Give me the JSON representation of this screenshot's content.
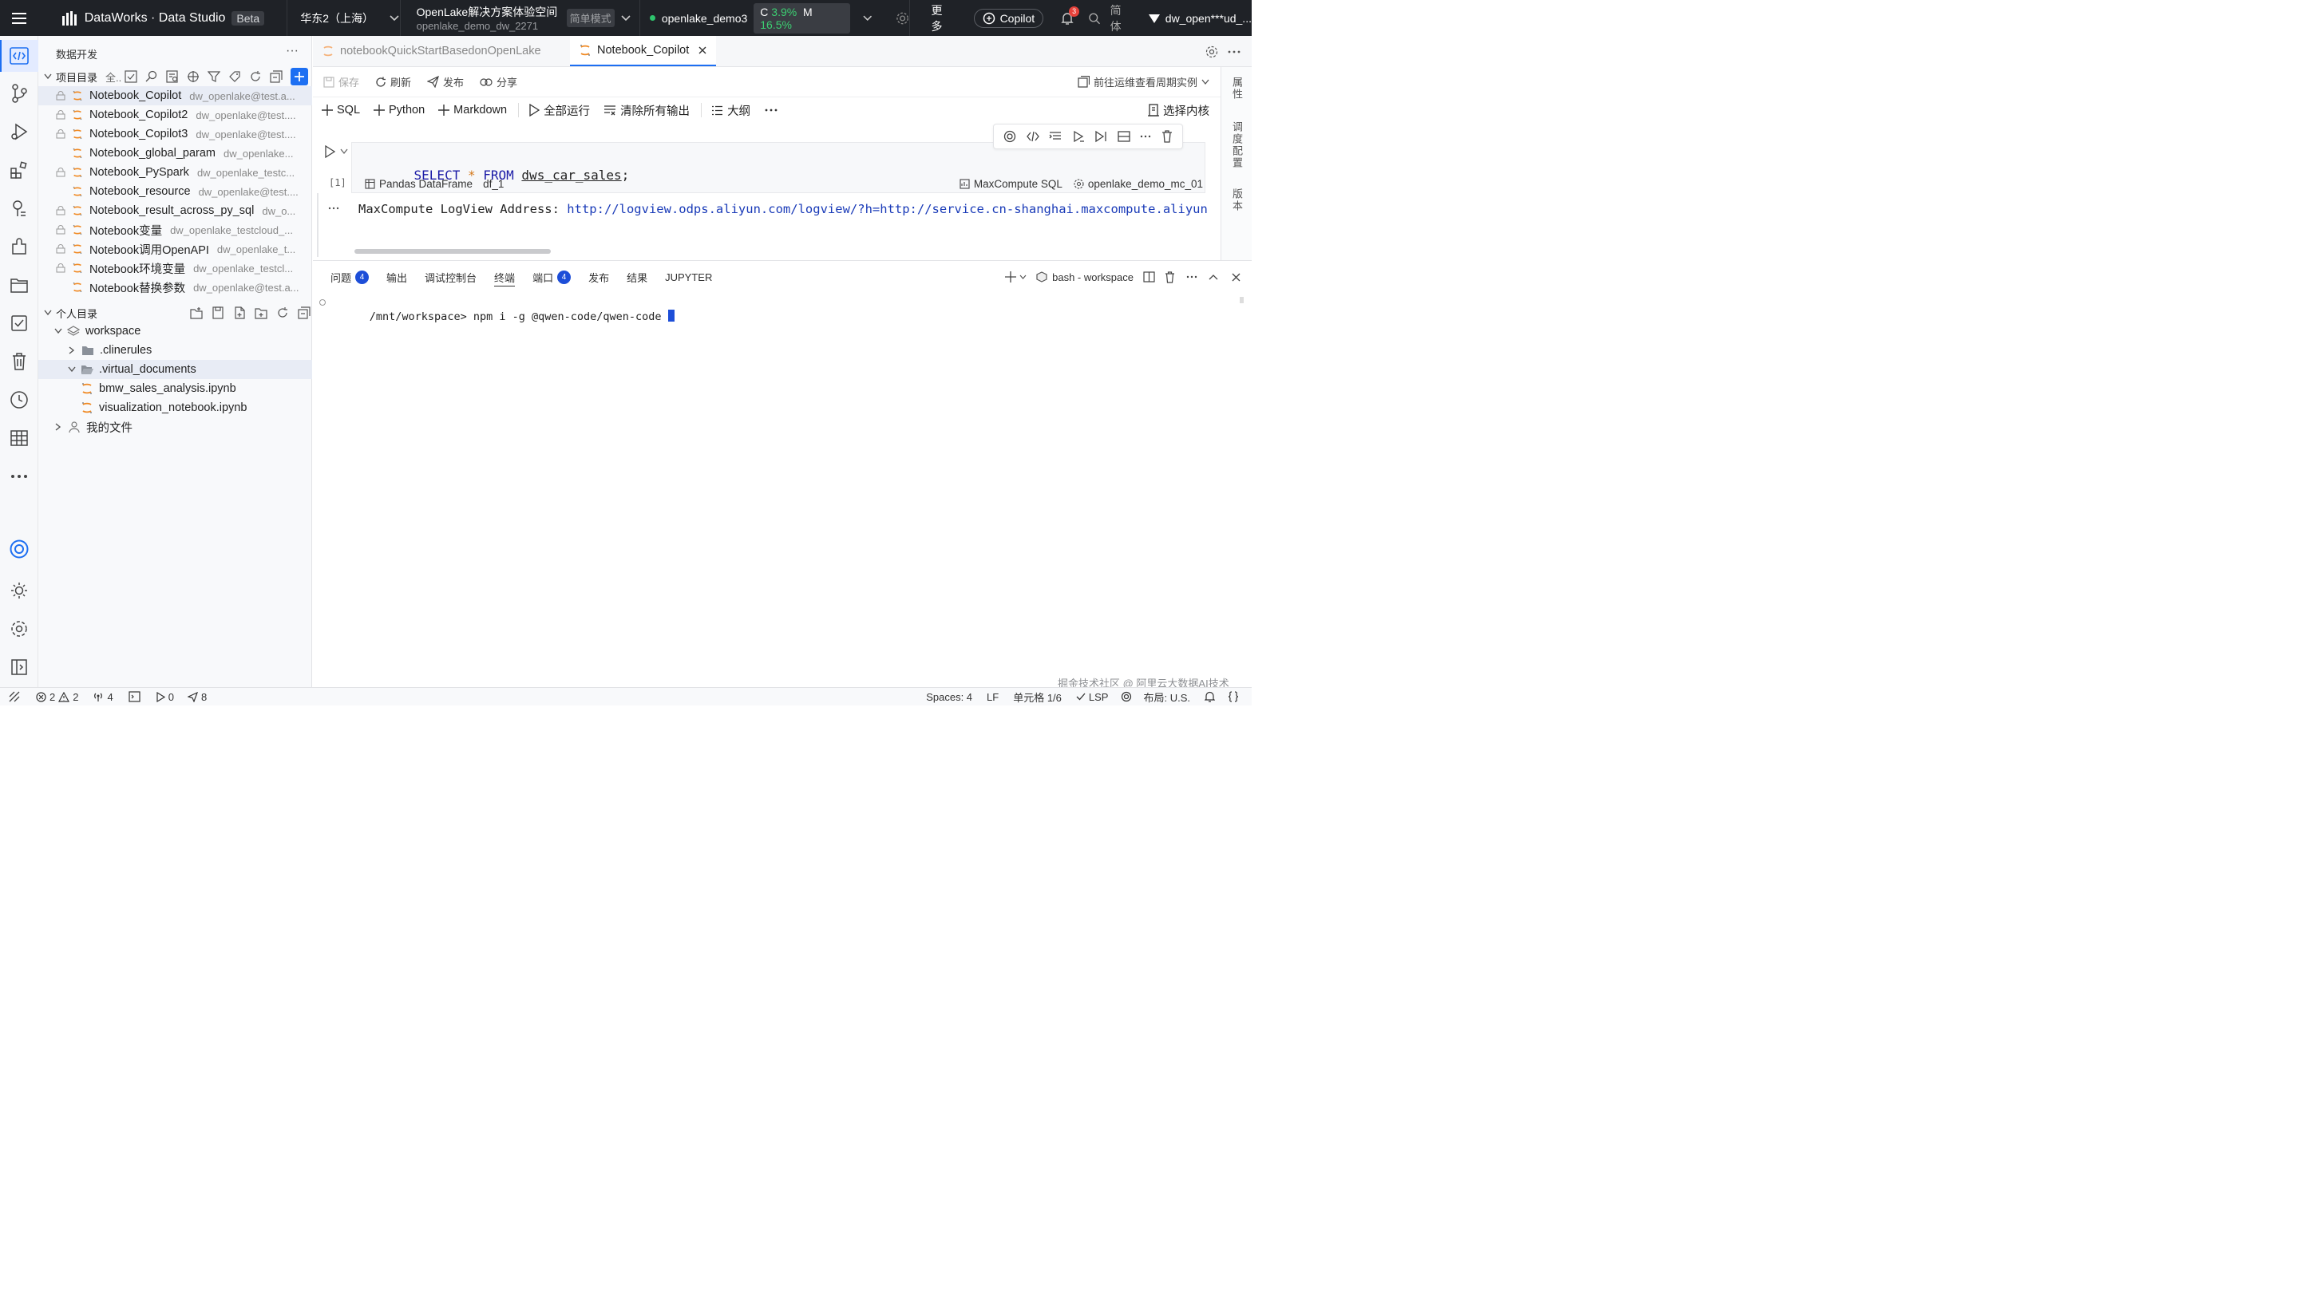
{
  "topbar": {
    "app_name": "DataWorks · Data Studio",
    "beta": "Beta",
    "region": "华东2（上海）",
    "workspace_name": "OpenLake解决方案体验空间",
    "workspace_id": "openlake_demo_dw_2271",
    "mode": "简单模式",
    "resource_group": "openlake_demo3",
    "cpu_label": "C",
    "cpu_value": "3.9%",
    "mem_label": "M",
    "mem_value": "16.5%",
    "more": "更多",
    "copilot": "Copilot",
    "notifications": "3",
    "lang": "简体",
    "user": "dw_open***ud_..."
  },
  "explorer": {
    "title": "数据开发",
    "more": "···",
    "project_dir": "项目目录",
    "project_all": "全..",
    "personal_dir": "个人目录",
    "project_items": [
      {
        "name": "Notebook_Copilot",
        "owner": "dw_openlake@test.a...",
        "locked": true
      },
      {
        "name": "Notebook_Copilot2",
        "owner": "dw_openlake@test....",
        "locked": true
      },
      {
        "name": "Notebook_Copilot3",
        "owner": "dw_openlake@test....",
        "locked": true
      },
      {
        "name": "Notebook_global_param",
        "owner": "dw_openlake...",
        "locked": false
      },
      {
        "name": "Notebook_PySpark",
        "owner": "dw_openlake_testc...",
        "locked": true
      },
      {
        "name": "Notebook_resource",
        "owner": "dw_openlake@test....",
        "locked": false
      },
      {
        "name": "Notebook_result_across_py_sql",
        "owner": "dw_o...",
        "locked": true
      },
      {
        "name": "Notebook变量",
        "owner": "dw_openlake_testcloud_...",
        "locked": true
      },
      {
        "name": "Notebook调用OpenAPI",
        "owner": "dw_openlake_t...",
        "locked": true
      },
      {
        "name": "Notebook环境变量",
        "owner": "dw_openlake_testcl...",
        "locked": true
      },
      {
        "name": "Notebook替换参数",
        "owner": "dw_openlake@test.a...",
        "locked": false
      }
    ],
    "personal_items": {
      "workspace": "workspace",
      "clinerules": ".clinerules",
      "virtual_documents": ".virtual_documents",
      "file1": "bmw_sales_analysis.ipynb",
      "file2": "visualization_notebook.ipynb",
      "my_files": "我的文件"
    }
  },
  "editor": {
    "tab1": "notebookQuickStartBasedonOpenLake",
    "tab2": "Notebook_Copilot",
    "toolbar1": {
      "save": "保存",
      "refresh": "刷新",
      "publish": "发布",
      "share": "分享",
      "goto_ops": "前往运维查看周期实例"
    },
    "toolbar2": {
      "sql": "SQL",
      "python": "Python",
      "markdown": "Markdown",
      "run_all": "全部运行",
      "clear_outputs": "清除所有输出",
      "outline": "大纲",
      "select_kernel": "选择内核"
    },
    "cell": {
      "exec_count": "[1]",
      "kw_select": "SELECT",
      "star": "*",
      "kw_from": "FROM",
      "table": "dws_car_sales",
      "semi": ";",
      "output_type": "Pandas DataFrame",
      "var_name": "df_1",
      "engine": "MaxCompute SQL",
      "compute": "openlake_demo_mc_01"
    },
    "output": {
      "prefix": "MaxCompute LogView Address: ",
      "link": "http://logview.odps.aliyun.com/logview/?h=http://service.cn-shanghai.maxcompute.aliyun-i"
    },
    "right_rail": [
      "属性",
      "调度配置",
      "版本"
    ]
  },
  "panel": {
    "tabs": [
      {
        "label": "问题",
        "badge": "4"
      },
      {
        "label": "输出"
      },
      {
        "label": "调试控制台"
      },
      {
        "label": "终端",
        "active": true
      },
      {
        "label": "端口",
        "badge": "4"
      },
      {
        "label": "发布"
      },
      {
        "label": "结果"
      },
      {
        "label": "JUPYTER"
      }
    ],
    "terminal_name": "bash - workspace",
    "prompt": "/mnt/workspace>",
    "command": "npm i -g @qwen-code/qwen-code"
  },
  "statusbar": {
    "errors": "2",
    "warnings": "2",
    "ports": "4",
    "runs": "0",
    "publishes": "8",
    "spaces": "Spaces: 4",
    "eol": "LF",
    "cell_pos": "单元格 1/6",
    "lsp": "LSP",
    "layout": "布局: U.S."
  },
  "watermark": "掘金技术社区 @ 阿里云大数据AI技术",
  "colors": {
    "accent": "#1d6ff2",
    "topbar": "#1f2227",
    "sql_keyword": "#1a1aa6"
  }
}
